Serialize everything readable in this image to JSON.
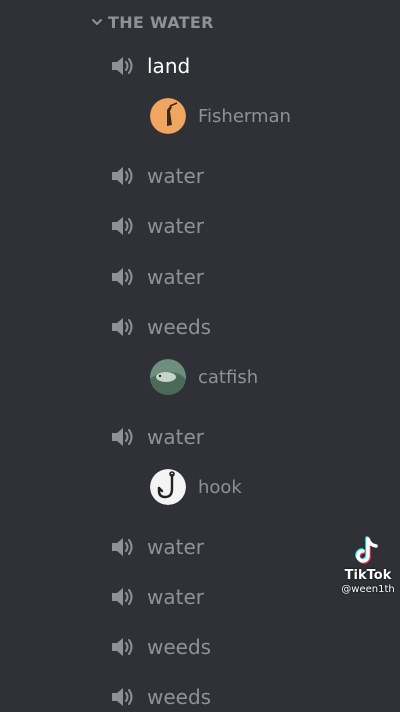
{
  "category": {
    "label": "THE WATER",
    "icon": "chevron-down-icon"
  },
  "channels": [
    {
      "name": "land",
      "active": true,
      "icon": "speaker-icon"
    },
    {
      "name": "water",
      "active": false,
      "icon": "speaker-icon"
    },
    {
      "name": "water",
      "active": false,
      "icon": "speaker-icon"
    },
    {
      "name": "water",
      "active": false,
      "icon": "speaker-icon"
    },
    {
      "name": "weeds",
      "active": false,
      "icon": "speaker-icon"
    },
    {
      "name": "water",
      "active": false,
      "icon": "speaker-icon"
    },
    {
      "name": "water",
      "active": false,
      "icon": "speaker-icon"
    },
    {
      "name": "water",
      "active": false,
      "icon": "speaker-icon"
    },
    {
      "name": "weeds",
      "active": false,
      "icon": "speaker-icon"
    },
    {
      "name": "weeds",
      "active": false,
      "icon": "speaker-icon"
    }
  ],
  "members": [
    {
      "name": "Fisherman",
      "channel": "land"
    },
    {
      "name": "catfish",
      "channel": "weeds"
    },
    {
      "name": "hook",
      "channel": "water"
    }
  ],
  "watermark": {
    "brand": "TikTok",
    "handle": "@ween1th"
  },
  "colors": {
    "background": "#2f3136",
    "muted_text": "#8e9297",
    "active_text": "#ffffff"
  }
}
